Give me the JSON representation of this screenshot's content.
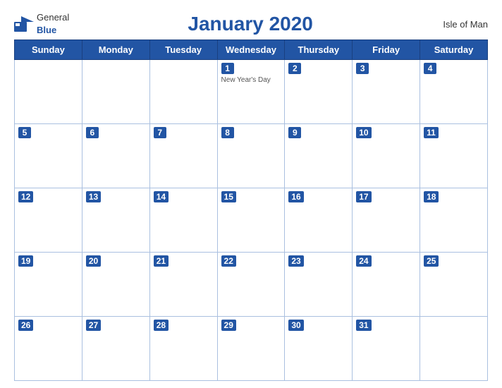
{
  "header": {
    "logo_general": "General",
    "logo_blue": "Blue",
    "title": "January 2020",
    "region": "Isle of Man"
  },
  "days_of_week": [
    "Sunday",
    "Monday",
    "Tuesday",
    "Wednesday",
    "Thursday",
    "Friday",
    "Saturday"
  ],
  "weeks": [
    [
      {
        "day": "",
        "event": ""
      },
      {
        "day": "",
        "event": ""
      },
      {
        "day": "",
        "event": ""
      },
      {
        "day": "1",
        "event": "New Year's Day"
      },
      {
        "day": "2",
        "event": ""
      },
      {
        "day": "3",
        "event": ""
      },
      {
        "day": "4",
        "event": ""
      }
    ],
    [
      {
        "day": "5",
        "event": ""
      },
      {
        "day": "6",
        "event": ""
      },
      {
        "day": "7",
        "event": ""
      },
      {
        "day": "8",
        "event": ""
      },
      {
        "day": "9",
        "event": ""
      },
      {
        "day": "10",
        "event": ""
      },
      {
        "day": "11",
        "event": ""
      }
    ],
    [
      {
        "day": "12",
        "event": ""
      },
      {
        "day": "13",
        "event": ""
      },
      {
        "day": "14",
        "event": ""
      },
      {
        "day": "15",
        "event": ""
      },
      {
        "day": "16",
        "event": ""
      },
      {
        "day": "17",
        "event": ""
      },
      {
        "day": "18",
        "event": ""
      }
    ],
    [
      {
        "day": "19",
        "event": ""
      },
      {
        "day": "20",
        "event": ""
      },
      {
        "day": "21",
        "event": ""
      },
      {
        "day": "22",
        "event": ""
      },
      {
        "day": "23",
        "event": ""
      },
      {
        "day": "24",
        "event": ""
      },
      {
        "day": "25",
        "event": ""
      }
    ],
    [
      {
        "day": "26",
        "event": ""
      },
      {
        "day": "27",
        "event": ""
      },
      {
        "day": "28",
        "event": ""
      },
      {
        "day": "29",
        "event": ""
      },
      {
        "day": "30",
        "event": ""
      },
      {
        "day": "31",
        "event": ""
      },
      {
        "day": "",
        "event": ""
      }
    ]
  ]
}
